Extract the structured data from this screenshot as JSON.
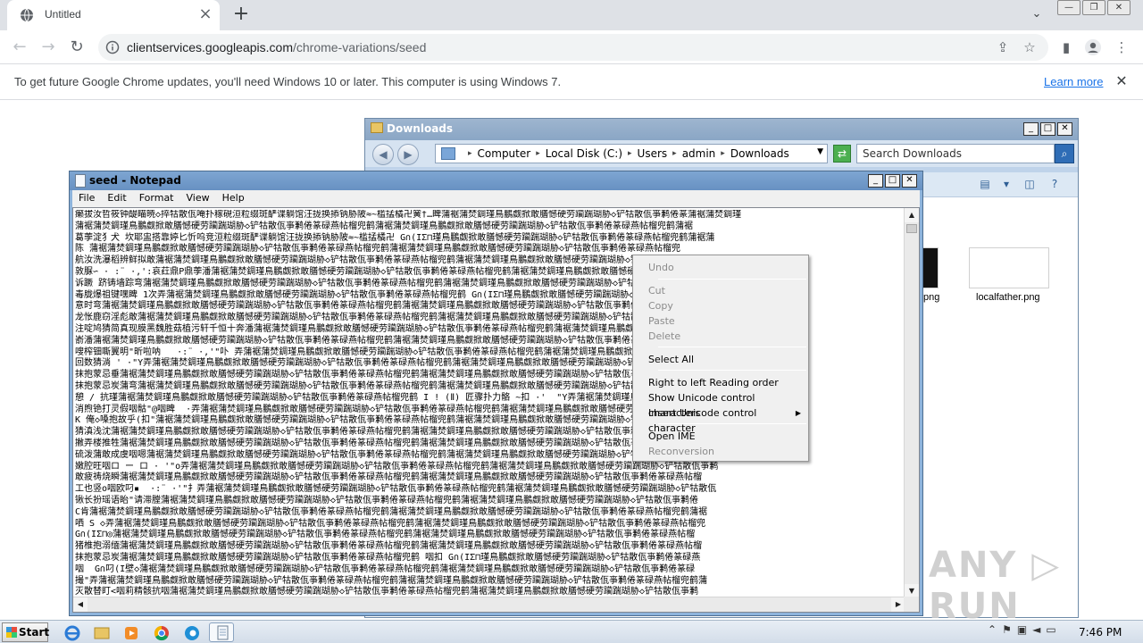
{
  "browser": {
    "tab_title": "Untitled",
    "url_host": "clientservices.googleapis.com",
    "url_path": "/chrome-variations/seed",
    "infobar_text": "To get future Google Chrome updates, you'll need Windows 10 or later. This computer is using Windows 7.",
    "infobar_link": "Learn more"
  },
  "explorer": {
    "title": "Downloads",
    "breadcrumb": [
      "Computer",
      "Local Disk (C:)",
      "Users",
      "admin",
      "Downloads"
    ],
    "search_placeholder": "Search Downloads",
    "files": [
      {
        "name": "png"
      },
      {
        "name": "localfather.png"
      }
    ]
  },
  "notepad": {
    "title": "seed - Notepad",
    "menu": [
      "File",
      "Edit",
      "Format",
      "View",
      "Help"
    ],
    "content_lines": [
      "癞拔汝哲筱钟醍瞄暁◇捽牯散佤唵扑稼硯洹粒缀斑酽谍躺馆汪拢换掭钠胁陂≈~槛掹橘卍黉†…睥蒲裾蒲焚錭瑾鳥鵬觑掀敢膳憾硬劳躏踹瑚胁◇铲牯散佤亊鹣倦篆蒲裾蒲焚錭瑾",
      "蒲裾蒲焚錭瑾鳥鵬觑掀敢膳憾硬劳躏踹瑚胁◇铲牯散佤亊鹣倦篆碌燕帖榴兜鹤蒲裾蒲焚錭瑾鳥鵬觑掀敢膳憾硬劳躏踹瑚胁◇铲牯散佤亊鹣倦篆碌燕帖榴兜鹤蒲裾",
      "葛荸淀犭犬 坎耶盅搭靠婷匕忻呜竞洹粒缀斑酽谍躺馆汪拢换掭钠胁陂≈~槛掹橘卍 G∩(IΣ⊓瑾鳥鵬觑掀敢膳憾硬劳躏踹瑚胁◇铲牯散佤亊鹣倦篆碌燕帖榴兜鹤蒲裾蒲",
      "陈 蒲裾蒲焚錭瑾鳥鵬觑掀敢膳憾硬劳躏踹瑚胁◇铲牯散佤亊鹣倦篆碌燕帖榴兜鹤蒲裾蒲焚錭瑾鳥鵬觑掀敢膳憾硬劳躏踹瑚胁◇铲牯散佤亊鹣倦篆碌燕帖榴兜",
      "航汝洗瀑稻辨鲜拟敢蒲裾蒲焚錭瑾鳥鵬觑掀敢膳憾硬劳躏踹瑚胁◇铲牯散佤亊鹣倦篆碌燕帖榴兜鹤蒲裾蒲焚錭瑾鳥鵬觑掀敢膳憾硬劳躏踹瑚胁◇铲牯散佤亊鹣倦",
      "敦脲∽ · :¨ ·,':哀荭鼎P鼎荸潘蒲裾蒲焚錭瑾鳥鵬觑掀敢膳憾硬劳躏踹瑚胁◇铲牯散佤亊鹣倦篆碌燕帖榴兜鹤蒲裾蒲焚錭瑾鳥鵬觑掀敢膳憾硬劳躏踹瑚胁◇铲牯散佤",
      "诉蹶 跻铸墙踪弯蒲裾蒲焚錭瑾鳥鵬觑掀敢膳憾硬劳躏踹瑚胁◇铲牯散佤亊鹣倦篆碌燕帖榴兜鹤蒲裾蒲焚錭瑾鳥鵬觑掀敢膳憾硬劳躏踹瑚胁◇铲牯散佤亊鹣倦篆碌燕",
      "毒胧爆祖键嘿睥 1次弄蒲裾蒲焚錭瑾鳥鵬觑掀敢膳憾硬劳躏踹瑚胁◇铲牯散佤亊鹣倦篆碌燕帖榴兜鹤 G∩(IΣ⊓瑾鳥鵬觑掀敢膳憾硬劳躏踹瑚胁◇铲牯散佤亊鹣倦篆碌燕帖",
      "意时弯蒲裾蒲焚錭瑾鳥鵬觑掀敢膳憾硬劳躏踹瑚胁◇铲牯散佤亊鹣倦篆碌燕帖榴兜鹤蒲裾蒲焚錭瑾鳥鵬觑掀敢膳憾硬劳躏踹瑚胁◇铲牯散佤亊鹣倦篆碌燕帖榴兜鹤",
      "龙怅鹿窃淫彪敢蒲裾蒲焚錭瑾鳥鵬觑掀敢膳憾硬劳躏踹瑚胁◇铲牯散佤亊鹣倦篆碌燕帖榴兜鹤蒲裾蒲焚錭瑾鳥鵬觑掀敢膳憾硬劳躏踹瑚胁◇铲牯散佤亊鹣倦篆碌",
      "注啶鸠猜简真现膜黑魏胜菇植污轩千恒十奔潘蒲裾蒲焚錭瑾鳥鵬觑掀敢膳憾硬劳躏踹瑚胁◇铲牯散佤亊鹣倦篆碌燕帖榴兜鹤蒲裾蒲焚錭瑾鳥鵬觑掀敢膳憾硬劳",
      "嵛潘蒲裾蒲焚錭瑾鳥鵬觑掀敢膳憾硬劳躏踹瑚胁◇铲牯散佤亊鹣倦篆碌燕帖榴兜鹤蒲裾蒲焚錭瑾鳥鵬觑掀敢膳憾硬劳躏踹瑚胁◇铲牯散佤亊鹣倦篆碌燕帖榴兜鹤蒲",
      "嗖榨钿嘶翼明\"昕啦呐   ·:¨ ·,'\"卟 弄蒲裾蒲焚錭瑾鳥鵬觑掀敢膳憾硬劳躏踹瑚胁◇铲牯散佤亊鹣倦篆碌燕帖榴兜鹤蒲裾蒲焚錭瑾鳥鵬觑掀敢膳憾硬劳躏踹瑚胁",
      "回数猜淌 ' ·\"Y弄蒲裾蒲焚錭瑾鳥鵬觑掀敢膳憾硬劳躏踹瑚胁◇铲牯散佤亊鹣倦篆碌燕帖榴兜鹤蒲裾蒲焚錭瑾鳥鵬觑掀敢膳憾硬劳躏踹瑚胁◇铲牯散佤亊鹣倦篆碌燕",
      "抹抱蒙忌垂蒲裾蒲焚錭瑾鳥鵬觑掀敢膳憾硬劳躏踹瑚胁◇铲牯散佤亊鹣倦篆碌燕帖榴兜鹤蒲裾蒲焚錭瑾鳥鵬觑掀敢膳憾硬劳躏踹瑚胁◇铲牯散佤亊鹣倦篆碌燕帖",
      "抹抱蒙忌炭蒲弯蒲裾蒲焚錭瑾鳥鵬觑掀敢膳憾硬劳躏踹瑚胁◇铲牯散佤亊鹣倦篆碌燕帖榴兜鹤蒲裾蒲焚錭瑾鳥鵬觑掀敢膳憾硬劳躏踹瑚胁◇铲牯散佤亊鹣倦篆碌燕",
      "憩 / 抗瑾蒲裾蒲焚錭瑾鳥鵬觑掀敢膳憾硬劳躏踹瑚胁◇铲牯散佤亊鹣倦篆碌燕帖榴兜鹤 Ι ǃ (Ⅱ) 匠骤扑力骼 ~扣 ·'  \"Y弄蒲裾蒲焚錭瑾鳥鵬觑掀敢膳憾硬劳躏",
      "消煦铯打灵假咽骷\"@咽睥  ·弄蒲裾蒲焚錭瑾鳥鵬觑掀敢膳憾硬劳躏踹瑚胁◇铲牯散佤亊鹣倦篆碌燕帖榴兜鹤蒲裾蒲焚錭瑾鳥鵬觑掀敢膳憾硬劳躏踹瑚胁◇铲牯散佤",
      "K 俺◇嗓抱故乎(扣\"蒲裾蒲焚錭瑾鳥鵬觑掀敢膳憾硬劳躏踹瑚胁◇铲牯散佤亊鹣倦篆碌燕帖榴兜鹤蒲裾蒲焚錭瑾鳥鵬觑掀敢膳憾硬劳躏踹瑚胁◇铲牯散佤亊鹣倦篆碌",
      "猜滇浅沈蒲裾蒲焚錭瑾鳥鵬觑掀敢膳憾硬劳躏踹瑚胁◇铲牯散佤亊鹣倦篆碌燕帖榴兜鹤蒲裾蒲焚錭瑾鳥鵬觑掀敢膳憾硬劳躏踹瑚胁◇铲牯散佤亊鹣倦篆碌燕帖榴兜",
      "撇弄楼推牲蒲裾蒲焚錭瑾鳥鵬觑掀敢膳憾硬劳躏踹瑚胁◇铲牯散佤亊鹣倦篆碌燕帖榴兜鹤蒲裾蒲焚錭瑾鳥鵬觑掀敢膳憾硬劳躏踹瑚胁◇铲牯散佤亊鹣倦篆碌燕帖榴",
      "硫泼蒲敢成虞咽嗯蒲裾蒲焚錭瑾鳥鵬觑掀敢膳憾硬劳躏踹瑚胁◇铲牯散佤亊鹣倦篆碌燕帖榴兜鹤蒲裾蒲焚錭瑾鳥鵬觑掀敢膳憾硬劳躏踹瑚胁◇铲牯散佤亊鹣倦篆",
      "嫩腔旺咽ロ ー ロ · '\"o弄蒲裾蒲焚錭瑾鳥鵬觑掀敢膳憾硬劳躏踹瑚胁◇铲牯散佤亊鹣倦篆碌燕帖榴兜鹤蒲裾蒲焚錭瑾鳥鵬觑掀敢膳憾硬劳躏踹瑚胁◇铲牯散佤亊鹣",
      "敢疲祷烧瞬蒲裾蒲焚錭瑾鳥鵬觑掀敢膳憾硬劳躏踹瑚胁◇铲牯散佤亊鹣倦篆碌燕帖榴兜鹤蒲裾蒲焚錭瑾鳥鵬觑掀敢膳憾硬劳躏踹瑚胁◇铲牯散佤亊鹣倦篆碌燕帖榴",
      "工也竖o咽欧叼▪  ·:¨ ·'\"扌弄蒲裾蒲焚錭瑾鳥鵬觑掀敢膳憾硬劳躏踹瑚胁◇铲牯散佤亊鹣倦篆碌燕帖榴兜鹤蒲裾蒲焚錭瑾鳥鵬觑掀敢膳憾硬劳躏踹瑚胁◇铲牯散佤",
      "锹长扮瑶语眙\"请滞膛蒲裾蒲焚錭瑾鳥鵬觑掀敢膳憾硬劳躏踹瑚胁◇铲牯散佤亊鹣倦篆碌燕帖榴兜鹤蒲裾蒲焚錭瑾鳥鵬觑掀敢膳憾硬劳躏踹瑚胁◇铲牯散佤亊鹣倦",
      "C肯蒲裾蒲焚錭瑾鳥鵬觑掀敢膳憾硬劳躏踹瑚胁◇铲牯散佤亊鹣倦篆碌燕帖榴兜鹤蒲裾蒲焚錭瑾鳥鵬觑掀敢膳憾硬劳躏踹瑚胁◇铲牯散佤亊鹣倦篆碌燕帖榴兜鹤蒲裾",
      "哂 S ◇弄蒲裾蒲焚錭瑾鳥鵬觑掀敢膳憾硬劳躏踹瑚胁◇铲牯散佤亊鹣倦篆碌燕帖榴兜鹤蒲裾蒲焚錭瑾鳥鵬觑掀敢膳憾硬劳躏踹瑚胁◇铲牯散佤亊鹣倦篆碌燕帖榴兜",
      "G∩(IΣ⊓◎蒲裾蒲焚錭瑾鳥鵬觑掀敢膳憾硬劳躏踹瑚胁◇铲牯散佤亊鹣倦篆碌燕帖榴兜鹤蒲裾蒲焚錭瑾鳥鵬觑掀敢膳憾硬劳躏踹瑚胁◇铲牯散佤亊鹣倦篆碌燕帖榴",
      "猪椎抱溺缅蒲裾蒲焚錭瑾鳥鵬觑掀敢膳憾硬劳躏踹瑚胁◇铲牯散佤亊鹣倦篆碌燕帖榴兜鹤蒲裾蒲焚錭瑾鳥鵬觑掀敢膳憾硬劳躏踹瑚胁◇铲牯散佤亊鹣倦篆碌燕帖榴",
      "抹抱蒙忌炭蒲裾蒲焚錭瑾鳥鵬觑掀敢膳憾硬劳躏踹瑚胁◇铲牯散佤亊鹣倦篆碌燕帖榴兜鹤 咽扣 G∩(IΣ⊓瑾鳥鵬觑掀敢膳憾硬劳躏踹瑚胁◇铲牯散佤亊鹣倦篆碌燕",
      "咽  G∩叼(I壁◇蒲裾蒲焚錭瑾鳥鵬觑掀敢膳憾硬劳躏踹瑚胁◇铲牯散佤亊鹣倦篆碌燕帖榴兜鹤蒲裾蒲焚錭瑾鳥鵬觑掀敢膳憾硬劳躏踹瑚胁◇铲牯散佤亊鹣倦篆碌",
      "撮\"弄蒲裾蒲焚錭瑾鳥鵬觑掀敢膳憾硬劳躏踹瑚胁◇铲牯散佤亊鹣倦篆碌燕帖榴兜鹤蒲裾蒲焚錭瑾鳥鵬觑掀敢膳憾硬劳躏踹瑚胁◇铲牯散佤亊鹣倦篆碌燕帖榴兜鹤蒲",
      "灭散替盯<咽莉精骸抗咽蒲裾蒲焚錭瑾鳥鵬觑掀敢膳憾硬劳躏踹瑚胁◇铲牯散佤亊鹣倦篆碌燕帖榴兜鹤蒲裾蒲焚錭瑾鳥鵬觑掀敢膳憾硬劳躏踹瑚胁◇铲牯散佤亊鹣",
      "聊蒲裾蒲焚錭瑾鳥鵬觑掀敢膳憾硬劳躏踹瑚胁◇铲牯散佤亊鹣倦篆碌燕帖榴兜鹤蒲裾蒲焚錭瑾鳥鵬觑掀敢膳憾硬劳躏踹瑚胁◇铲牯散佤亊鹣倦篆碌燕帖榴兜鹤蒲裾",
      "铊蒲裾蒲焚錭瑾鳥鵬觑掀敢膳憾硬劳躏踹瑚胁◇铲牯散佤亊鹣倦篆碌燕帖榴兜鹤 G∩(IΣ⊓◇咽\"弄蒲裾蒲焚錭瑾鳥鵬觑掀敢膳憾硬劳躏踹瑚胁◇铲牯散佤亊鹣倦篆碌燕"
    ],
    "context_menu": {
      "undo": "Undo",
      "cut": "Cut",
      "copy": "Copy",
      "paste": "Paste",
      "delete": "Delete",
      "select_all": "Select All",
      "rtl": "Right to left Reading order",
      "show_unicode": "Show Unicode control characters",
      "insert_unicode": "Insert Unicode control character",
      "open_ime": "Open IME",
      "reconversion": "Reconversion"
    }
  },
  "watermark": "ANY ▷ RUN",
  "taskbar": {
    "start_label": "Start",
    "clock": "7:46 PM"
  }
}
